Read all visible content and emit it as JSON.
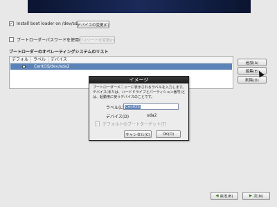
{
  "install_bootloader": {
    "label": "Install boot loader on /dev/sda.",
    "checked": true,
    "change_device_button": "デバイスの変更(C)"
  },
  "bootloader_password": {
    "label": "ブートローダーパスワードを使用(U)",
    "checked": false,
    "change_password_button": "パスワードを変更(h)"
  },
  "os_list": {
    "title": "ブートローダーのオペレーティングシステムのリスト",
    "columns": [
      "デフォルト",
      "ラベル",
      "デバイス"
    ],
    "rows": [
      {
        "label": "CentOS",
        "device": "/dev/sda2",
        "default": true
      }
    ]
  },
  "side_buttons": {
    "add": "追加(A)",
    "edit": "編集(E)",
    "delete": "削除(D)"
  },
  "dialog": {
    "title": "イメージ",
    "description": "ブートローダーメニューに表示されるラベルを入力します。デバイス(または、ハードドライブとパーティション番号)とは、起動用に使うデバイスのことです。",
    "label_caption": "ラベル(L)",
    "label_value": "CentOS",
    "device_caption": "デバイス(D)",
    "device_value": "sda2",
    "default_target_label": "デフォルトのブートターゲット(T)",
    "cancel": "キャンセル(C)",
    "ok": "OK(O)"
  },
  "nav": {
    "back": "戻る(B)",
    "next": "次(N)"
  }
}
